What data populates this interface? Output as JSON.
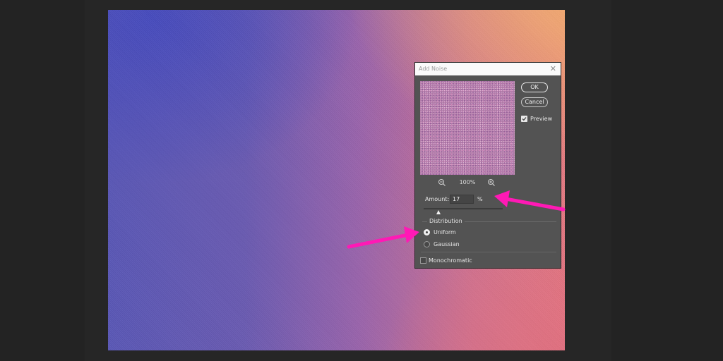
{
  "dialog": {
    "title": "Add Noise",
    "close_glyph": "✕",
    "ok_label": "OK",
    "cancel_label": "Cancel",
    "preview_label": "Preview",
    "preview_checked": true,
    "zoom_level": "100%",
    "amount_label": "Amount:",
    "amount_value": "17",
    "amount_unit": "%",
    "slider_value_percent": 17,
    "distribution_label": "Distribution",
    "distribution_options": [
      "Uniform",
      "Gaussian"
    ],
    "distribution_selected": "Uniform",
    "monochromatic_label": "Monochromatic",
    "monochromatic_checked": false
  },
  "icons": {
    "zoom_out": "zoom-out-icon",
    "zoom_in": "zoom-in-icon",
    "close": "close-icon",
    "checkmark": "checkmark-icon"
  },
  "colors": {
    "annotation_arrow": "#ff19b5",
    "dialog_background": "#535353",
    "canvas_purple": "#5a57b6",
    "canvas_peach": "#f6b66e",
    "canvas_pink": "#e47a82"
  }
}
